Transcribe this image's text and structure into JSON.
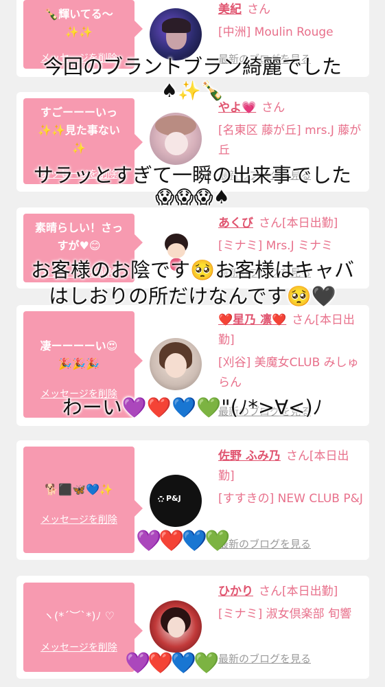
{
  "cards": [
    {
      "message_lines": [
        "🍾輝いてる〜",
        "✨✨"
      ],
      "delete_label": "メッセージを削除",
      "name": "美紀",
      "suffix": "さん",
      "shop": "[中洲] Moulin Rouge",
      "blog_label": "最新のブログを見る"
    },
    {
      "message_lines": [
        "すごーーーいっ",
        "✨✨見た事ない",
        "✨"
      ],
      "delete_label": "メッセージを削除",
      "name": "やよ💗",
      "suffix": "さん",
      "shop": "[名東区 藤が丘] mrs.J 藤が丘",
      "blog_label": "最新のブログを見る"
    },
    {
      "message_lines": [
        "素晴らしい！さっ",
        "すが♥😊"
      ],
      "delete_label": "メッセージを削除",
      "name": "あくび",
      "suffix": "さん[本日出勤]",
      "shop": "[ミナミ] Mrs.J ミナミ",
      "blog_label": "最新のブログを見る"
    },
    {
      "message_lines": [
        "凄ーーーーい😍",
        "🎉🎉🎉"
      ],
      "delete_label": "メッセージを削除",
      "name": "❤️星乃 凛❤️",
      "suffix": "さん[本日出勤]",
      "shop": "[刈谷] 美魔女CLUB みしゅらん",
      "blog_label": "最新のブログを見る"
    },
    {
      "message_lines": [
        "🐕⬛🦋💙✨"
      ],
      "delete_label": "メッセージを削除",
      "name": "佐野 ふみ乃",
      "suffix": "さん[本日出勤]",
      "shop": "[すすきの] NEW CLUB P&J",
      "blog_label": "最新のブログを見る",
      "avatar_text": "P&J"
    },
    {
      "message_lines": [
        "ヽ(*´︶`*)ﾉ ♡"
      ],
      "delete_label": "メッセージを削除",
      "name": "ひかり",
      "suffix": "さん[本日出勤]",
      "shop": "[ミナミ] 淑女倶楽部 旬響",
      "blog_label": "最新のブログを見る"
    }
  ],
  "overlays": [
    "今回のブラントブラン綺麗でした",
    "♠✨🍾",
    "サラッとすぎて一瞬の出来事でした",
    "😱😱😱♠",
    "お客様のお陰です🥺お客様はキャバ",
    "はしおりの所だけなんです🥺🖤",
    "わーい💜❤️💙💚\"(ﾉ*>∀<)ﾉ",
    "💜❤️💙💚",
    "💜❤️💙💚"
  ],
  "colors": {
    "bubble": "#f79ab0",
    "name": "#e0546f",
    "shop": "#e8708b",
    "background": "#f0f0f0"
  }
}
